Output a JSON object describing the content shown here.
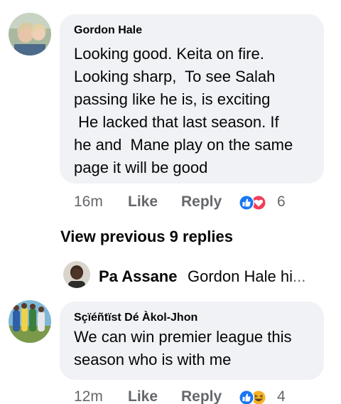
{
  "comments": [
    {
      "author": "Gordon Hale",
      "lines": [
        "Looking good. Keita on fire.",
        "Looking sharp,  To see Salah",
        "passing like he is, is exciting",
        " He lacked that last season. If",
        "he and  Mane play on the same",
        "page it will be good"
      ],
      "time": "16m",
      "like": "Like",
      "reply": "Reply",
      "reaction_count": "6",
      "reactions": [
        "like-icon",
        "love-icon"
      ]
    },
    {
      "author": "Sçïéñtïst Dé Àkol-Jhon",
      "lines": [
        "We can win premier league this",
        "season who is with me"
      ],
      "time": "12m",
      "like": "Like",
      "reply": "Reply",
      "reaction_count": "4",
      "reactions": [
        "like-icon",
        "haha-icon"
      ]
    }
  ],
  "view_previous": "View previous 9 replies",
  "reply_preview": {
    "author": "Pa Assane",
    "text": "Gordon Hale hi",
    "ellipsis": "..."
  },
  "colors": {
    "bubble": "#f0f2f5",
    "meta": "#65676b",
    "like_blue": "#1877f2",
    "love_red": "#f33e58",
    "haha_yellow": "#f7b125"
  }
}
